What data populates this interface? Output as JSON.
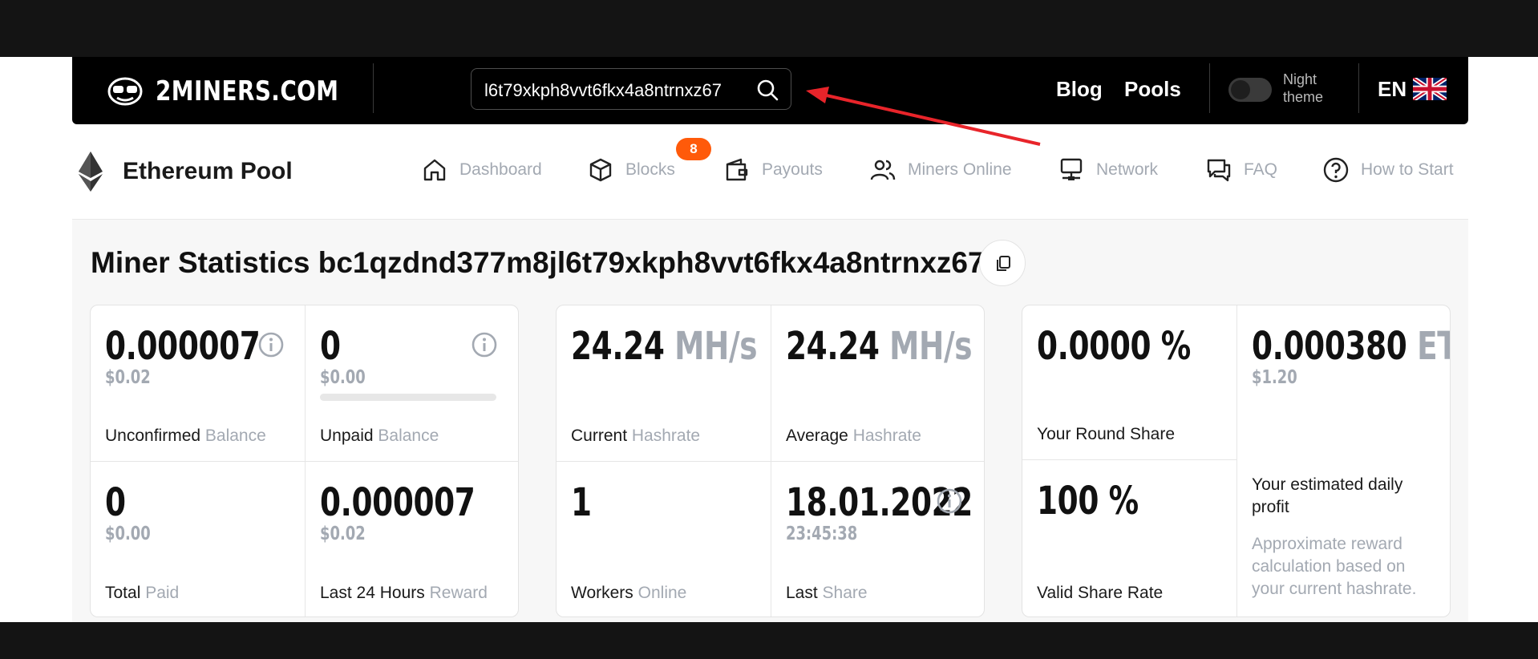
{
  "header": {
    "logo_text": "2MINERS.COM",
    "search": {
      "value": "l6t79xkph8vvt6fkx4a8ntrnxz67",
      "icon": "search-icon"
    },
    "links": [
      "Blog",
      "Pools"
    ],
    "night_theme_label": "Night theme",
    "language": "EN"
  },
  "subnav": {
    "pool_title": "Ethereum Pool",
    "items": [
      {
        "label": "Dashboard",
        "icon": "home-icon"
      },
      {
        "label": "Blocks",
        "icon": "cube-icon",
        "badge": "8"
      },
      {
        "label": "Payouts",
        "icon": "wallet-icon"
      },
      {
        "label": "Miners Online",
        "icon": "users-icon"
      },
      {
        "label": "Network",
        "icon": "network-icon"
      },
      {
        "label": "FAQ",
        "icon": "chat-icon"
      },
      {
        "label": "How to Start",
        "icon": "help-circle-icon"
      }
    ]
  },
  "main": {
    "title": "Miner Statistics bc1qzdnd377m8jl6t79xkph8vvt6fkx4a8ntrnxz67",
    "balance_card": {
      "unconfirmed": {
        "value": "0.000007",
        "usd": "$0.02",
        "label": "Unconfirmed",
        "label_muted": "Balance"
      },
      "unpaid": {
        "value": "0",
        "usd": "$0.00",
        "label": "Unpaid",
        "label_muted": "Balance",
        "progress": 0
      },
      "total_paid": {
        "value": "0",
        "usd": "$0.00",
        "label": "Total",
        "label_muted": "Paid"
      },
      "last24": {
        "value": "0.000007",
        "usd": "$0.02",
        "label": "Last 24 Hours",
        "label_muted": "Reward"
      }
    },
    "hashrate_card": {
      "current": {
        "value": "24.24",
        "unit": "MH/s",
        "label": "Current",
        "label_muted": "Hashrate"
      },
      "average": {
        "value": "24.24",
        "unit": "MH/s",
        "label": "Average",
        "label_muted": "Hashrate"
      },
      "workers": {
        "value": "1",
        "label": "Workers",
        "label_muted": "Online"
      },
      "last_share": {
        "date": "18.01.2022",
        "time": "23:45:38",
        "label": "Last",
        "label_muted": "Share"
      }
    },
    "share_card": {
      "round_share": {
        "value": "0.0000 %",
        "label": "Your Round Share"
      },
      "valid_rate": {
        "value": "100 %",
        "label": "Valid Share Rate"
      },
      "daily": {
        "value": "0.000380",
        "unit": "ETH",
        "usd": "$1.20",
        "label": "Your estimated daily profit",
        "note": "Approximate reward calculation based on your current hashrate."
      }
    }
  },
  "colors": {
    "accent": "#ff5a0a",
    "muted": "#a3a9b2",
    "annotation_arrow": "#e8242a"
  }
}
